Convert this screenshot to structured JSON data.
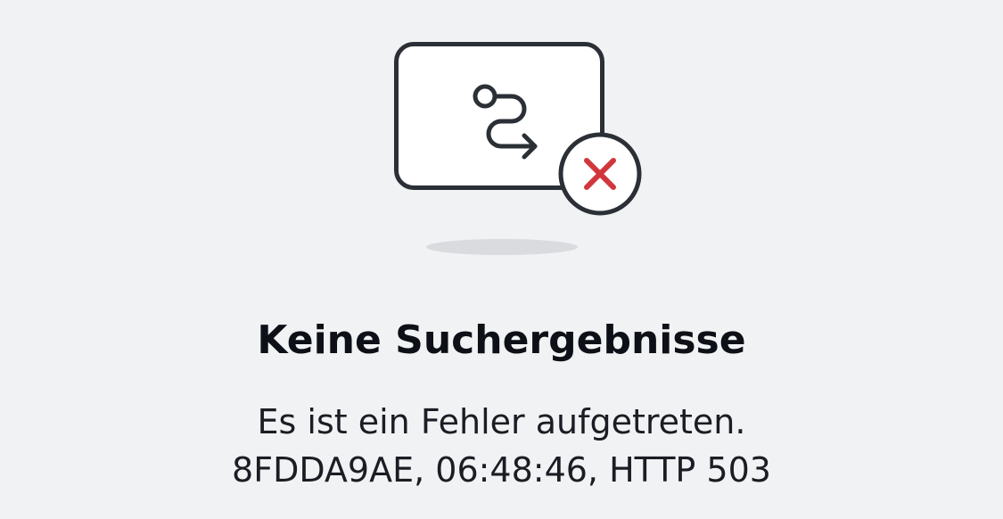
{
  "illustration": {
    "card_icon": "route-icon",
    "badge_icon": "close-icon",
    "badge_color": "#d0363b"
  },
  "title": "Keine Suchergebnisse",
  "message": {
    "line1": "Es ist ein Fehler aufgetreten.",
    "line2": "8FDDA9AE, 06:48:46, HTTP 503"
  }
}
